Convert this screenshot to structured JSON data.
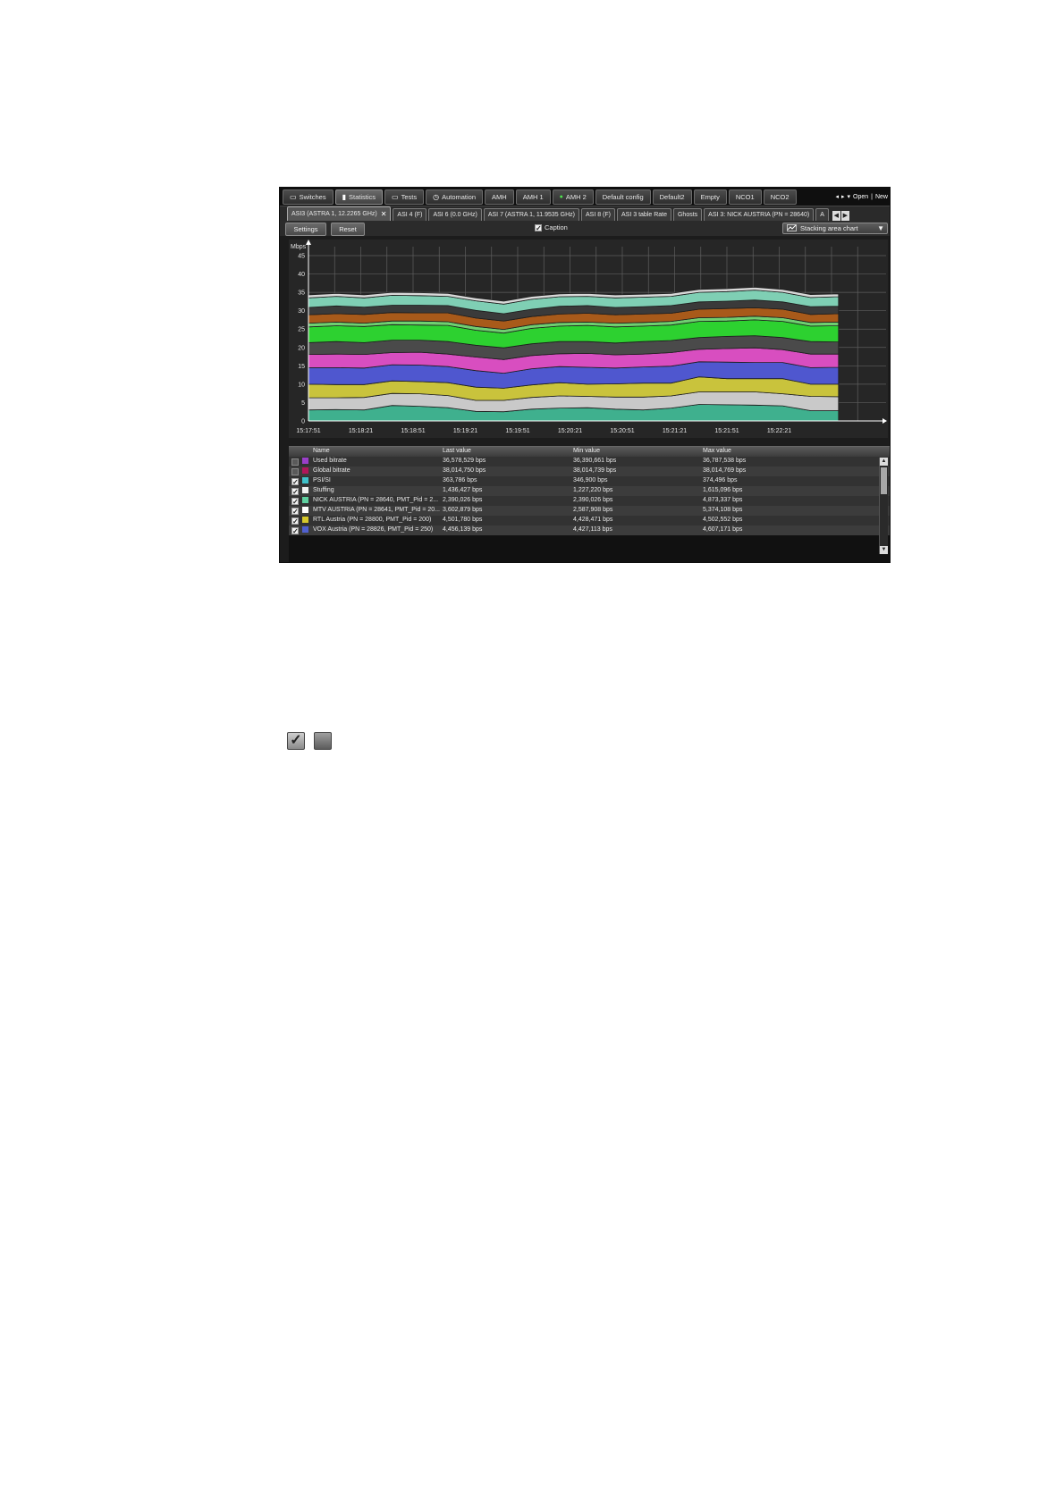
{
  "top_tabs": [
    {
      "label": "Switches",
      "icon": "monitor-icon",
      "active": false,
      "dot": false
    },
    {
      "label": "Statistics",
      "icon": "bar-chart-icon",
      "active": true,
      "dot": false
    },
    {
      "label": "Tests",
      "icon": "monitor-check-icon",
      "active": false,
      "dot": false
    },
    {
      "label": "Automation",
      "icon": "clock-icon",
      "active": false,
      "dot": false
    },
    {
      "label": "AMH",
      "icon": "",
      "active": false,
      "dot": false
    },
    {
      "label": "AMH 1",
      "icon": "",
      "active": false,
      "dot": false
    },
    {
      "label": "AMH 2",
      "icon": "",
      "active": false,
      "dot": true
    },
    {
      "label": "Default config",
      "icon": "",
      "active": false,
      "dot": false
    },
    {
      "label": "Default2",
      "icon": "",
      "active": false,
      "dot": false
    },
    {
      "label": "Empty",
      "icon": "",
      "active": false,
      "dot": false
    },
    {
      "label": "NCO1",
      "icon": "",
      "active": false,
      "dot": false
    },
    {
      "label": "NCO2",
      "icon": "",
      "active": false,
      "dot": false
    }
  ],
  "top_nav": {
    "open_label": "Open",
    "separator": "|",
    "new_label": "New"
  },
  "sub_tabs": [
    {
      "label": "ASI3 (ASTRA 1, 12.2265 GHz)",
      "active": true,
      "closable": true
    },
    {
      "label": "ASI 4 (F)",
      "active": false,
      "closable": false
    },
    {
      "label": "ASI 6 (0.0 GHz)",
      "active": false,
      "closable": false
    },
    {
      "label": "ASI 7 (ASTRA 1, 11.9535 GHz)",
      "active": false,
      "closable": false
    },
    {
      "label": "ASI 8 (F)",
      "active": false,
      "closable": false
    },
    {
      "label": "ASI 3 table Rate",
      "active": false,
      "closable": false
    },
    {
      "label": "Ghosts",
      "active": false,
      "closable": false
    },
    {
      "label": "ASI 3: NICK AUSTRIA (PN = 28640)",
      "active": false,
      "closable": false
    },
    {
      "label": "A",
      "active": false,
      "closable": false
    }
  ],
  "toolbar": {
    "settings_label": "Settings",
    "reset_label": "Reset",
    "caption_label": "Caption",
    "caption_checked": true,
    "chart_type_label": "Stacking area chart"
  },
  "chart_data": {
    "type": "area",
    "stacked": true,
    "ylabel": "Mbps",
    "ylim": [
      0,
      45
    ],
    "yticks": [
      0,
      5,
      10,
      15,
      20,
      25,
      30,
      35,
      40,
      45
    ],
    "xticks": [
      "15:17:51",
      "15:18:21",
      "15:18:51",
      "15:19:21",
      "15:19:51",
      "15:20:21",
      "15:20:51",
      "15:21:21",
      "15:21:51",
      "15:22:21"
    ],
    "x_step_seconds": 30,
    "x_range_seconds": [
      0,
      300
    ],
    "grid": true,
    "colors": {
      "background": "#262626",
      "grid": "#5e5e5e",
      "series_line": "#1e1e1e",
      "layers": [
        "#3fb08e",
        "#c9c9c9",
        "#c9c33c",
        "#4f57cf",
        "#d84ec0",
        "#4a4a4a",
        "#2dd130",
        "#6fcf70",
        "#a85a1a",
        "#3a3a3a",
        "#7fcfb4",
        "#d8d8d8"
      ]
    },
    "x_seconds": [
      0,
      16,
      32,
      48,
      64,
      80,
      96,
      112,
      128,
      144,
      160,
      176,
      192,
      208,
      224,
      240,
      256,
      272,
      288,
      304
    ],
    "layers": [
      [
        3.0,
        3.1,
        3.0,
        4.2,
        4.0,
        3.6,
        2.6,
        2.5,
        3.2,
        3.5,
        3.6,
        3.2,
        3.0,
        3.5,
        4.5,
        4.4,
        4.3,
        4.1,
        2.8,
        2.8
      ],
      [
        3.3,
        3.2,
        3.4,
        3.3,
        3.4,
        3.3,
        3.0,
        3.1,
        3.2,
        3.3,
        3.1,
        3.3,
        3.5,
        3.3,
        3.4,
        3.5,
        3.6,
        3.3,
        3.9,
        3.8
      ],
      [
        3.7,
        3.6,
        3.5,
        3.4,
        3.3,
        3.5,
        3.6,
        3.3,
        3.4,
        3.6,
        3.3,
        3.6,
        3.8,
        3.5,
        4.1,
        3.6,
        3.6,
        4.1,
        3.3,
        3.4
      ],
      [
        4.5,
        4.6,
        4.5,
        4.4,
        4.5,
        4.4,
        4.5,
        4.1,
        4.4,
        4.4,
        4.6,
        4.3,
        4.4,
        4.6,
        4.1,
        4.5,
        4.4,
        4.4,
        4.5,
        4.6
      ],
      [
        3.6,
        3.7,
        3.7,
        3.3,
        3.5,
        3.4,
        3.7,
        3.7,
        3.6,
        3.5,
        3.8,
        3.6,
        3.5,
        3.7,
        3.4,
        3.7,
        4.0,
        3.5,
        3.7,
        3.6
      ],
      [
        3.2,
        3.4,
        3.2,
        3.4,
        3.3,
        3.4,
        3.2,
        3.2,
        3.2,
        3.3,
        3.2,
        3.2,
        3.4,
        3.3,
        3.2,
        3.3,
        3.3,
        3.3,
        3.4,
        3.3
      ],
      [
        4.3,
        4.3,
        4.4,
        4.2,
        4.1,
        4.4,
        4.1,
        4.0,
        4.2,
        4.2,
        4.4,
        4.4,
        4.2,
        4.2,
        4.4,
        4.2,
        4.3,
        4.4,
        4.2,
        4.4
      ],
      [
        1.0,
        1.0,
        0.9,
        1.0,
        1.1,
        1.0,
        1.0,
        1.0,
        1.0,
        1.0,
        0.9,
        1.0,
        1.0,
        1.0,
        1.0,
        1.0,
        1.0,
        1.0,
        1.0,
        1.0
      ],
      [
        2.3,
        2.3,
        2.4,
        2.3,
        2.2,
        2.4,
        2.3,
        2.3,
        2.2,
        2.3,
        2.4,
        2.3,
        2.3,
        2.2,
        2.3,
        2.4,
        2.3,
        2.3,
        2.2,
        2.3
      ],
      [
        2.0,
        2.1,
        2.0,
        2.0,
        2.1,
        2.0,
        2.1,
        2.0,
        2.0,
        2.1,
        2.1,
        2.0,
        2.0,
        2.1,
        2.0,
        2.0,
        2.1,
        2.0,
        2.1,
        2.0
      ],
      [
        2.6,
        2.6,
        2.5,
        2.7,
        2.6,
        2.5,
        2.6,
        2.6,
        2.7,
        2.6,
        2.5,
        2.6,
        2.6,
        2.5,
        2.6,
        2.6,
        2.7,
        2.6,
        2.5,
        2.6
      ],
      [
        0.8,
        0.8,
        0.8,
        0.8,
        0.8,
        0.8,
        0.8,
        0.8,
        0.8,
        0.8,
        0.8,
        0.8,
        0.8,
        0.8,
        0.8,
        0.8,
        0.8,
        0.8,
        0.8,
        0.8
      ]
    ]
  },
  "table": {
    "headers": [
      "Name",
      "Last value",
      "Min value",
      "Max value"
    ],
    "rows": [
      {
        "checked": false,
        "color": "#9a3fc9",
        "name": "Used bitrate",
        "last": "36,578,529 bps",
        "min": "36,390,661 bps",
        "max": "36,787,538 bps"
      },
      {
        "checked": false,
        "color": "#b0175a",
        "name": "Global bitrate",
        "last": "38,014,750 bps",
        "min": "38,014,739 bps",
        "max": "38,014,769 bps"
      },
      {
        "checked": true,
        "color": "#3fc1c9",
        "name": "PSI/SI",
        "last": "363,786 bps",
        "min": "346,900 bps",
        "max": "374,496 bps"
      },
      {
        "checked": true,
        "color": "#f2f2f2",
        "name": "Stuffing",
        "last": "1,436,427 bps",
        "min": "1,227,220 bps",
        "max": "1,615,096 bps"
      },
      {
        "checked": true,
        "color": "#5fd0a0",
        "name": "NICK AUSTRIA (PN = 28640, PMT_Pid = 2...",
        "last": "2,390,026 bps",
        "min": "2,390,026 bps",
        "max": "4,873,337 bps"
      },
      {
        "checked": true,
        "color": "#ffffff",
        "name": "MTV AUSTRIA (PN = 28641, PMT_Pid = 20...",
        "last": "3,602,879 bps",
        "min": "2,587,908 bps",
        "max": "5,374,108 bps"
      },
      {
        "checked": true,
        "color": "#d6c82c",
        "name": "RTL Austria (PN = 28800, PMT_Pid = 200)",
        "last": "4,501,780 bps",
        "min": "4,428,471 bps",
        "max": "4,502,552 bps"
      },
      {
        "checked": true,
        "color": "#5060d0",
        "name": "VOX Austria (PN = 28826, PMT_Pid = 250)",
        "last": "4,456,139 bps",
        "min": "4,427,113 bps",
        "max": "4,607,171 bps"
      }
    ]
  },
  "legend_icons": {
    "checked": true,
    "unchecked": false
  }
}
